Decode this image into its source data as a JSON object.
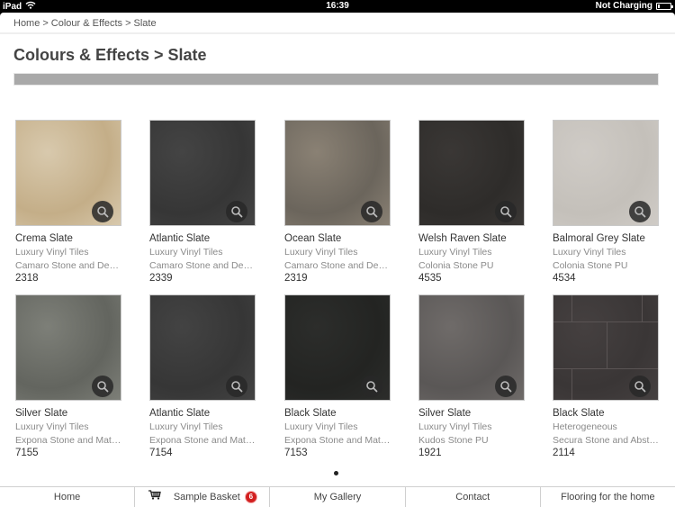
{
  "status_bar": {
    "device": "iPad",
    "time": "16:39",
    "battery_status": "Not Charging",
    "icons": [
      "wifi-icon",
      "battery-icon"
    ]
  },
  "breadcrumb": {
    "items": [
      "Home",
      "Colour & Effects",
      "Slate"
    ],
    "separator": ">"
  },
  "page": {
    "title": "Colours & Effects > Slate"
  },
  "products": [
    {
      "name": "Crema Slate",
      "category": "Luxury Vinyl Tiles",
      "range": "Camaro Stone and De…",
      "code": "2318",
      "swatch_color": "#d8c9ad",
      "swatch_color2": "#c4ae88"
    },
    {
      "name": "Atlantic Slate",
      "category": "Luxury Vinyl Tiles",
      "range": "Camaro Stone and De…",
      "code": "2339",
      "swatch_color": "#444444",
      "swatch_color2": "#363636"
    },
    {
      "name": "Ocean Slate",
      "category": "Luxury Vinyl Tiles",
      "range": "Camaro Stone and De…",
      "code": "2319",
      "swatch_color": "#8a8174",
      "swatch_color2": "#6b655c"
    },
    {
      "name": "Welsh Raven Slate",
      "category": "Luxury Vinyl Tiles",
      "range": "Colonia Stone PU",
      "code": "4535",
      "swatch_color": "#3a3735",
      "swatch_color2": "#2e2c2a"
    },
    {
      "name": "Balmoral Grey Slate",
      "category": "Luxury Vinyl Tiles",
      "range": "Colonia Stone PU",
      "code": "4534",
      "swatch_color": "#cfcbc6",
      "swatch_color2": "#c4c0ba"
    },
    {
      "name": "Silver Slate",
      "category": "Luxury Vinyl Tiles",
      "range": "Expona Stone and Mat…",
      "code": "7155",
      "swatch_color": "#7d7f78",
      "swatch_color2": "#63655f"
    },
    {
      "name": "Atlantic Slate",
      "category": "Luxury Vinyl Tiles",
      "range": "Expona Stone and Mat…",
      "code": "7154",
      "swatch_color": "#434343",
      "swatch_color2": "#363636"
    },
    {
      "name": "Black Slate",
      "category": "Luxury Vinyl Tiles",
      "range": "Expona Stone and Mat…",
      "code": "7153",
      "swatch_color": "#2c2d2b",
      "swatch_color2": "#232422"
    },
    {
      "name": "Silver Slate",
      "category": "Luxury Vinyl Tiles",
      "range": "Kudos Stone PU",
      "code": "1921",
      "swatch_color": "#6f6b69",
      "swatch_color2": "#5a5756"
    },
    {
      "name": "Black Slate",
      "category": "Heterogeneous",
      "range": "Secura Stone and Abst…",
      "code": "2114",
      "swatch_color": "#454040",
      "swatch_color2": "#3a3636"
    }
  ],
  "pagination": {
    "current_page": 1,
    "total_pages": 1
  },
  "tabbar": {
    "items": [
      {
        "label": "Home"
      },
      {
        "label": "Sample Basket",
        "badge": "6"
      },
      {
        "label": "My Gallery"
      },
      {
        "label": "Contact"
      },
      {
        "label": "Flooring for the home"
      }
    ]
  },
  "colors": {
    "badge": "#d21f1f",
    "filter_bar": "#a9a9a9"
  }
}
